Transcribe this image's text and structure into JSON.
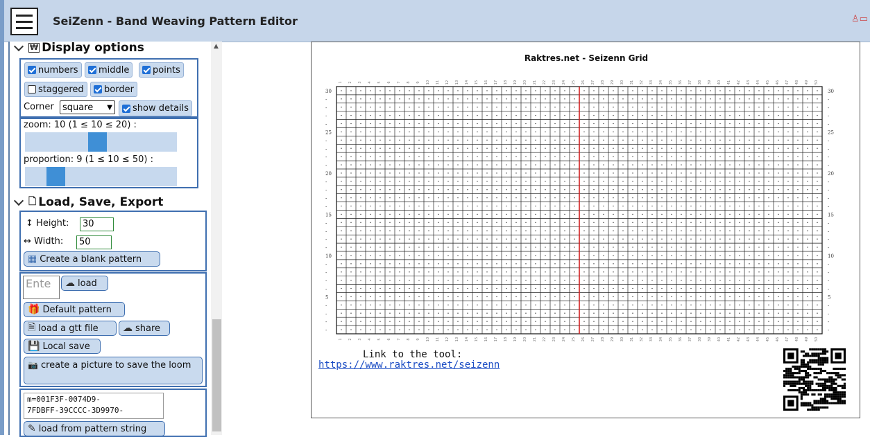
{
  "app": {
    "title": "SeiZenn - Band Weaving Pattern Editor"
  },
  "display_options": {
    "title": "Display options",
    "checkboxes": [
      {
        "label": "numbers",
        "checked": true
      },
      {
        "label": "middle",
        "checked": true
      },
      {
        "label": "points",
        "checked": true
      },
      {
        "label": "staggered",
        "checked": false
      },
      {
        "label": "border",
        "checked": true
      }
    ],
    "corner_label": "Corner",
    "corner_value": "square",
    "show_details": {
      "label": "show details",
      "checked": true
    },
    "zoom_label": "zoom: 10 (1 ≤ 10 ≤ 20) :",
    "zoom_value": 10,
    "proportion_label": "proportion: 9 (1 ≤ 10 ≤ 50) :",
    "proportion_value": 9
  },
  "load_save": {
    "title": "Load, Save, Export",
    "height_label": "Height:",
    "height_value": "30",
    "width_label": "Width:",
    "width_value": "50",
    "create_blank": "Create a blank pattern",
    "enter_placeholder": "Ente",
    "load": "load",
    "default_pattern": "Default pattern",
    "load_gtt": "load a gtt file",
    "share": "share",
    "local_save": "Local save",
    "create_picture": "create a picture to save the loom",
    "pattern_string": "m=001F3F-0074D9-\n7FDBFF-39CCCC-3D9970-",
    "load_from_string": "load from pattern string"
  },
  "grid": {
    "title": "Raktres.net - Seizenn Grid",
    "rows": 30,
    "cols": 50,
    "middle_col": 25,
    "row_labels": [
      "30",
      "25",
      "20",
      "15",
      "10",
      "5"
    ],
    "link_text": "Link to the tool:",
    "link_url": "https://www.raktres.net/seizenn"
  },
  "colors": {
    "accent": "#3f6fb0",
    "header": "#c6d6ea",
    "middle_line": "#d02020"
  }
}
